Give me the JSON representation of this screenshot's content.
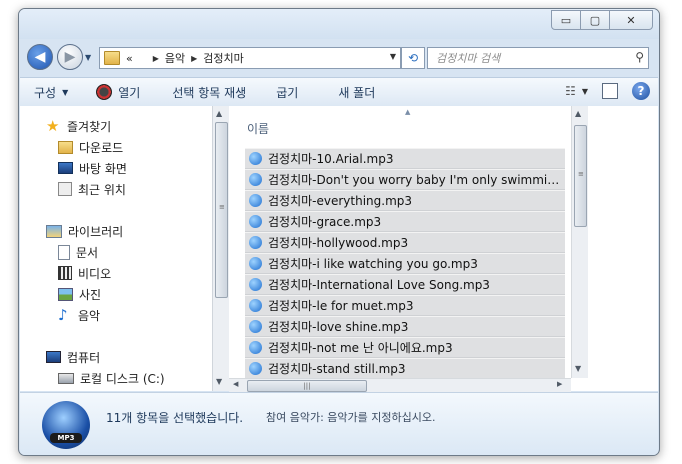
{
  "address": {
    "parts": [
      "«",
      "음악",
      "검정치마"
    ]
  },
  "search": {
    "placeholder": "검정치마 검색"
  },
  "toolbar": {
    "organize": "구성",
    "open": "열기",
    "play_selected": "선택 항목 재생",
    "burn": "굽기",
    "new_folder": "새 폴더"
  },
  "nav": {
    "favorites": "즐겨찾기",
    "downloads": "다운로드",
    "desktop": "바탕 화면",
    "recent": "최근 위치",
    "libraries": "라이브러리",
    "documents": "문서",
    "videos": "비디오",
    "pictures": "사진",
    "music": "음악",
    "computer": "컴퓨터",
    "local_disk": "로컬 디스크 (C:)"
  },
  "content": {
    "column_name": "이름",
    "files": [
      "검정치마-10.Arial.mp3",
      "검정치마-Don't you worry baby I'm only swimming....",
      "검정치마-everything.mp3",
      "검정치마-grace.mp3",
      "검정치마-hollywood.mp3",
      "검정치마-i like watching you go.mp3",
      "검정치마-International Love Song.mp3",
      "검정치마-le for muet.mp3",
      "검정치마-love shine.mp3",
      "검정치마-not me 난 아니에요.mp3",
      "검정치마-stand still.mp3"
    ]
  },
  "status": {
    "selected_text": "11개 항목을 선택했습니다.",
    "genre_text": "참여 음악가: 음악가를 지정하십시오.",
    "logo_text": "MP3"
  }
}
